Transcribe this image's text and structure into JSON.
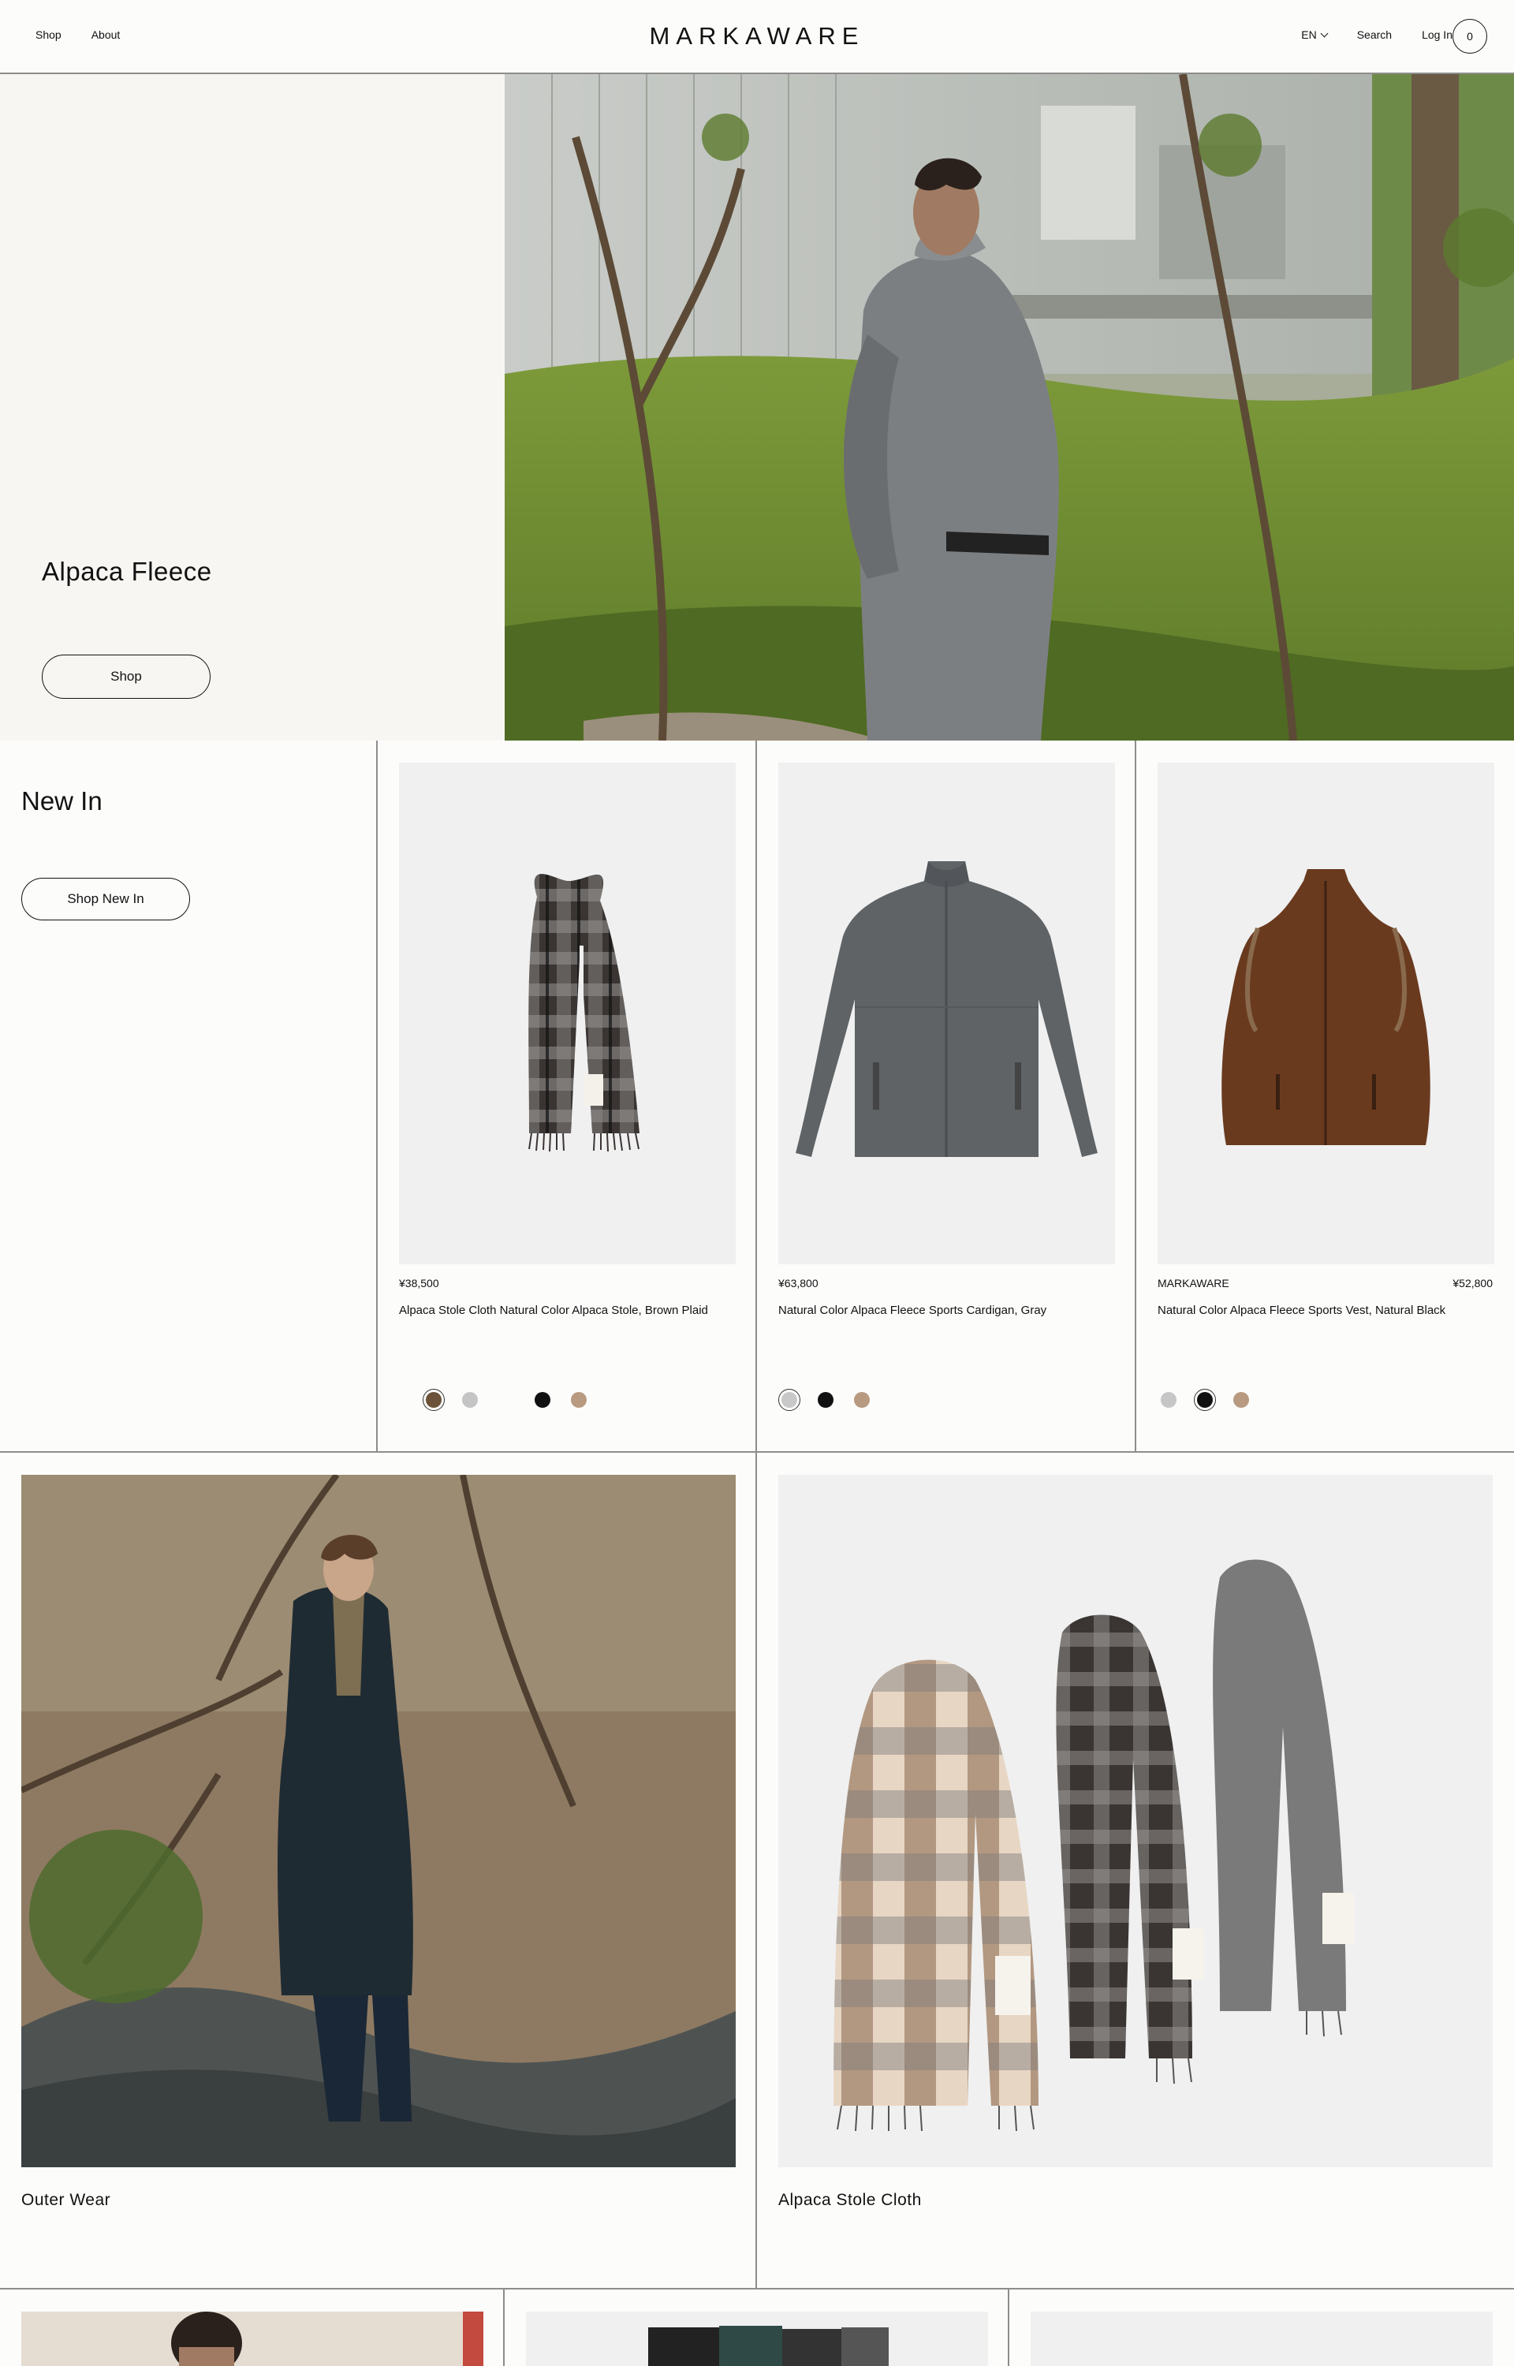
{
  "header": {
    "nav_left": [
      "Shop",
      "About"
    ],
    "logo": "MARKAWARE",
    "lang": "EN",
    "search": "Search",
    "login": "Log In",
    "cart_count": "0"
  },
  "hero": {
    "title": "Alpaca Fleece",
    "button": "Shop"
  },
  "new_in": {
    "title": "New In",
    "button": "Shop New In",
    "products": [
      {
        "price": "¥38,500",
        "name": "Alpaca Stole Cloth Natural Color Alpaca Stole, Brown Plaid",
        "swatches": [
          "#6b5238",
          "#c4c4c4",
          "#fcfcfb",
          "#111111",
          "#b89a80"
        ],
        "selected": 0
      },
      {
        "price": "¥63,800",
        "name": "Natural Color Alpaca Fleece Sports Cardigan, Gray",
        "swatches": [
          "#c8c8c8",
          "#111111",
          "#b89a80"
        ],
        "selected": 0
      },
      {
        "brand": "MARKAWARE",
        "price": "¥52,800",
        "name": "Natural Color Alpaca Fleece Sports Vest, Natural Black",
        "swatches": [
          "#c6c6c6",
          "#111111",
          "#b89a80",
          "#fcfcfb"
        ],
        "selected": 1
      }
    ]
  },
  "categories": [
    {
      "label": "Outer Wear"
    },
    {
      "label": "Alpaca Stole Cloth"
    }
  ]
}
